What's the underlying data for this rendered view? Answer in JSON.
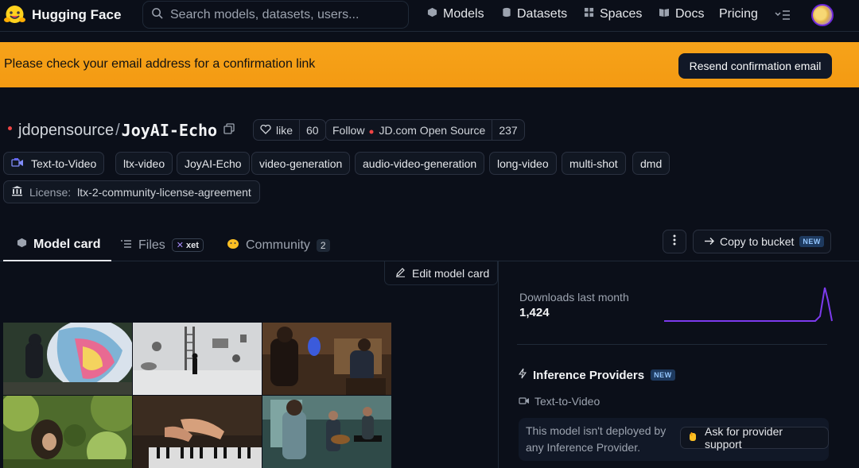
{
  "nav": {
    "brand": "Hugging Face",
    "search_placeholder": "Search models, datasets, users...",
    "items": [
      {
        "label": "Models",
        "icon": "cube-icon"
      },
      {
        "label": "Datasets",
        "icon": "database-icon"
      },
      {
        "label": "Spaces",
        "icon": "grid-icon"
      },
      {
        "label": "Docs",
        "icon": "book-icon"
      },
      {
        "label": "Pricing"
      }
    ]
  },
  "banner": {
    "text": "Please check your email address for a confirmation link",
    "button": "Resend confirmation email",
    "color": "#f59e0b"
  },
  "repo": {
    "owner": "jdopensource",
    "separator": "/",
    "name": "JoyAI-Echo",
    "like_label": "like",
    "like_count": "60",
    "follow_label": "Follow",
    "org_name": "JD.com Open Source",
    "follower_count": "237"
  },
  "tags": [
    {
      "label": "Text-to-Video",
      "icon": "text-to-video-icon"
    },
    {
      "label": "ltx-video"
    },
    {
      "label": "JoyAI-Echo"
    },
    {
      "label": "video-generation"
    },
    {
      "label": "audio-video-generation"
    },
    {
      "label": "long-video"
    },
    {
      "label": "multi-shot"
    },
    {
      "label": "dmd"
    }
  ],
  "license": {
    "prefix": "License:",
    "value": "ltx-2-community-license-agreement"
  },
  "tabs": {
    "model_card": "Model card",
    "files": "Files",
    "xet": "xet",
    "community": "Community",
    "community_count": "2",
    "copy_bucket": "Copy to bucket",
    "new_badge": "NEW"
  },
  "edit_card": "Edit model card",
  "downloads": {
    "label": "Downloads last month",
    "count": "1,424",
    "accent": "#7c3aed"
  },
  "inference": {
    "title": "Inference Providers",
    "new_badge": "NEW",
    "task": "Text-to-Video",
    "message": "This model isn't deployed by any Inference Provider.",
    "button": "Ask for provider support"
  }
}
